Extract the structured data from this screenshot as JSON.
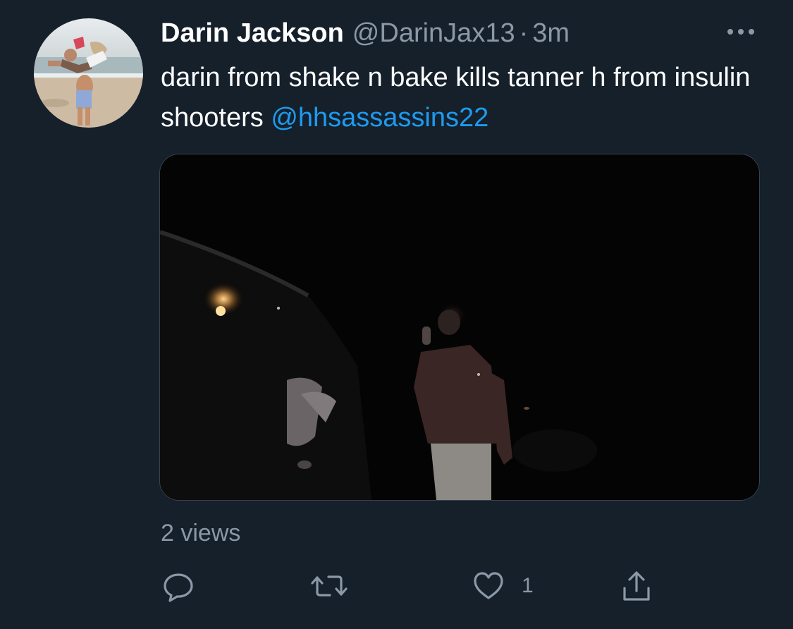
{
  "tweet": {
    "author": {
      "display_name": "Darin Jackson",
      "handle": "@DarinJax13",
      "separator": "·",
      "time": "3m"
    },
    "text": "darin from shake n bake kills tanner h from insulin shooters ",
    "mention": "@hhsassassins22",
    "views": "2 views",
    "actions": {
      "reply_icon": "reply-icon",
      "retweet_icon": "retweet-icon",
      "like_icon": "heart-icon",
      "like_count": "1",
      "share_icon": "share-icon"
    },
    "more_icon": "more-horizontal-icon"
  },
  "colors": {
    "background": "#15202b",
    "text_primary": "#ffffff",
    "text_secondary": "#8b98a5",
    "link": "#1d9bf0",
    "border": "#38444d"
  }
}
